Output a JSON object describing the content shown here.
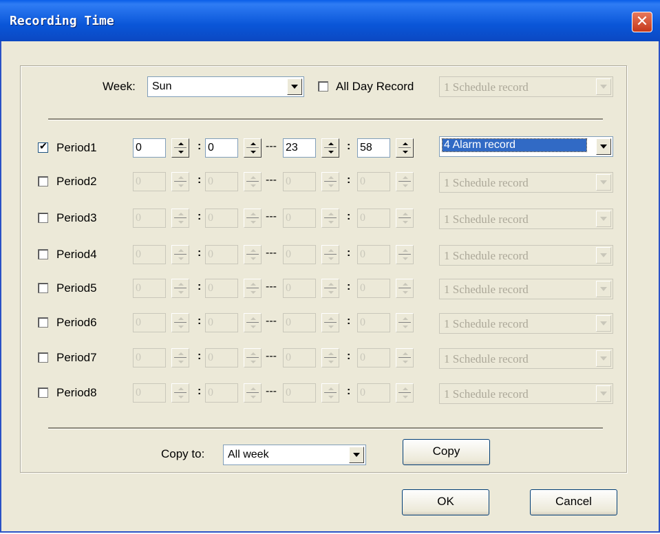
{
  "window": {
    "title": "Recording Time",
    "close_glyph": "✕"
  },
  "week": {
    "label": "Week:",
    "value": "Sun"
  },
  "all_day": {
    "label": "All Day Record",
    "checked": false
  },
  "all_day_type": {
    "value": "1 Schedule record"
  },
  "periods": [
    {
      "label": "Period1",
      "checked": true,
      "start_h": "0",
      "start_m": "0",
      "end_h": "23",
      "end_m": "58",
      "type": "4 Alarm record"
    },
    {
      "label": "Period2",
      "checked": false,
      "start_h": "0",
      "start_m": "0",
      "end_h": "0",
      "end_m": "0",
      "type": "1 Schedule record"
    },
    {
      "label": "Period3",
      "checked": false,
      "start_h": "0",
      "start_m": "0",
      "end_h": "0",
      "end_m": "0",
      "type": "1 Schedule record"
    },
    {
      "label": "Period4",
      "checked": false,
      "start_h": "0",
      "start_m": "0",
      "end_h": "0",
      "end_m": "0",
      "type": "1 Schedule record"
    },
    {
      "label": "Period5",
      "checked": false,
      "start_h": "0",
      "start_m": "0",
      "end_h": "0",
      "end_m": "0",
      "type": "1 Schedule record"
    },
    {
      "label": "Period6",
      "checked": false,
      "start_h": "0",
      "start_m": "0",
      "end_h": "0",
      "end_m": "0",
      "type": "1 Schedule record"
    },
    {
      "label": "Period7",
      "checked": false,
      "start_h": "0",
      "start_m": "0",
      "end_h": "0",
      "end_m": "0",
      "type": "1 Schedule record"
    },
    {
      "label": "Period8",
      "checked": false,
      "start_h": "0",
      "start_m": "0",
      "end_h": "0",
      "end_m": "0",
      "type": "1 Schedule record"
    }
  ],
  "separators": {
    "colon": ":",
    "dash": "---"
  },
  "copy": {
    "label": "Copy to:",
    "value": "All week",
    "button": "Copy"
  },
  "buttons": {
    "ok": "OK",
    "cancel": "Cancel"
  },
  "colors": {
    "title_bar": "#0a56d8",
    "dialog_bg": "#ece9d8",
    "selection": "#316ac5",
    "close": "#c4381a"
  }
}
